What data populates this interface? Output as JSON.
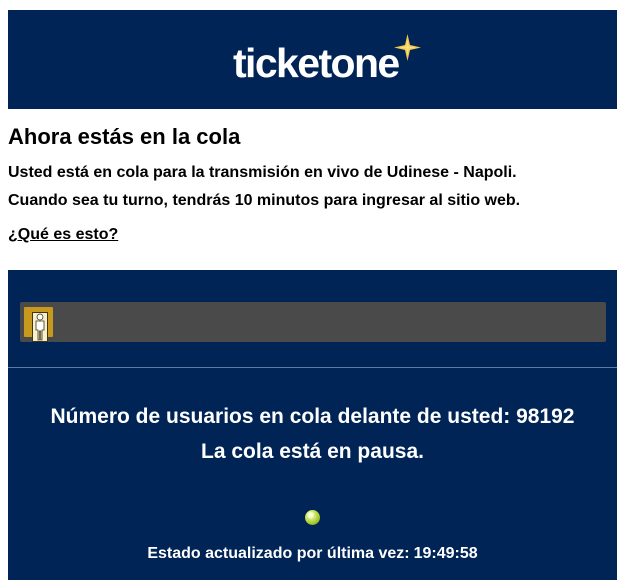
{
  "brand": {
    "name": "ticketone",
    "background": "#002455",
    "star_color": "#f2c94c"
  },
  "heading": {
    "title": "Ahora estás en la cola",
    "line1": "Usted está en cola para la transmisión en vivo de Udinese - Napoli.",
    "line2": "Cuando sea tu turno, tendrás 10 minutos para ingresar al sitio web.",
    "help_link": "¿Qué es esto?"
  },
  "queue": {
    "users_ahead": "Número de usuarios en cola delante de usted: 98192",
    "paused": "La cola está en pausa.",
    "progress_icon": "person-icon",
    "progress_fill_fraction": 0.05,
    "status_indicator_color": "#a5c72f",
    "updated_label": "Estado actualizado por última vez:",
    "updated_time": "19:49:58"
  }
}
